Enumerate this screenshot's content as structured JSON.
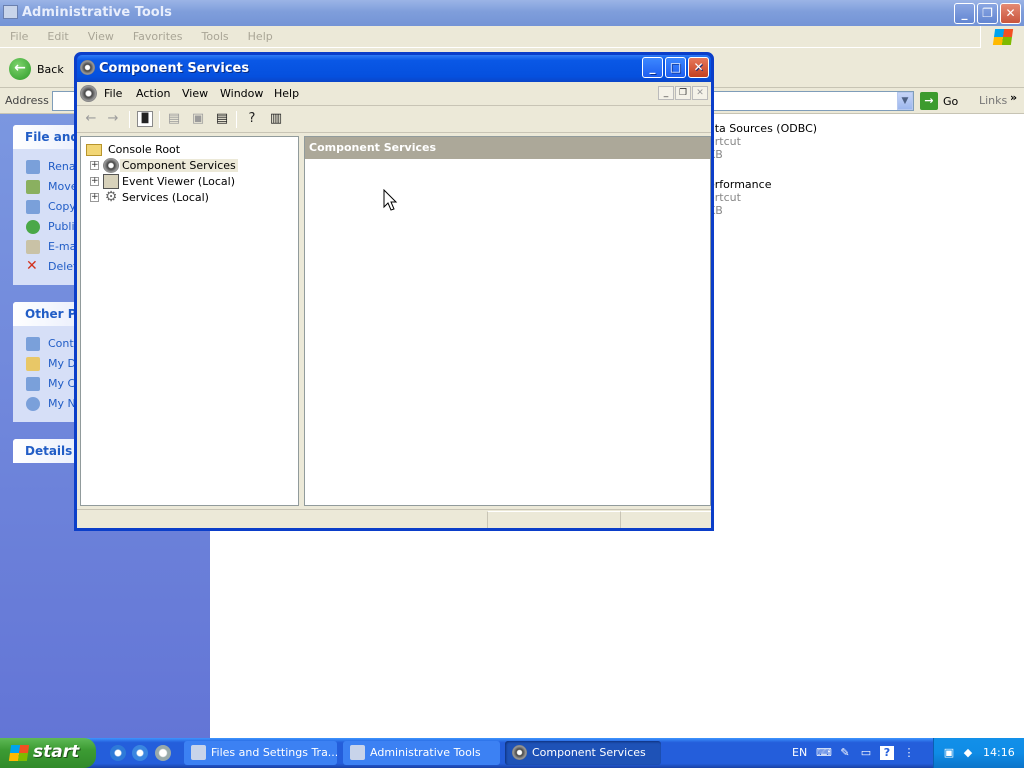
{
  "explorer": {
    "title": "Administrative Tools",
    "menu": [
      "File",
      "Edit",
      "View",
      "Favorites",
      "Tools",
      "Help"
    ],
    "back_label": "Back",
    "address_label": "Address",
    "go_label": "Go",
    "links_label": "Links",
    "task_pane": {
      "file_tasks": {
        "title": "File and F",
        "items": [
          "Rena",
          "Move",
          "Copy",
          "Publis",
          "E-mai",
          "Delet"
        ]
      },
      "other_places": {
        "title": "Other Pla",
        "items": [
          "Contr",
          "My Do",
          "My Co",
          "My Ne"
        ]
      },
      "details": {
        "title": "Details"
      }
    },
    "files": [
      {
        "name": "ata Sources (ODBC)",
        "type": "ortcut",
        "size": "KB"
      },
      {
        "name": "erformance",
        "type": "ortcut",
        "size": "KB"
      }
    ]
  },
  "component_services": {
    "title": "Component Services",
    "menu": [
      "File",
      "Action",
      "View",
      "Window",
      "Help"
    ],
    "tree": {
      "root": "Console Root",
      "nodes": [
        "Component Services",
        "Event Viewer (Local)",
        "Services (Local)"
      ]
    },
    "right_pane_title": "Component Services"
  },
  "taskbar": {
    "start_label": "start",
    "tasks": [
      "Files and Settings Tra...",
      "Administrative Tools",
      "Component Services"
    ],
    "language": "EN",
    "clock": "14:16"
  },
  "colors": {
    "title_active": "#0a58e6",
    "title_inactive": "#7f9edb",
    "taskbar": "#245edb",
    "start": "#3c9b33"
  }
}
